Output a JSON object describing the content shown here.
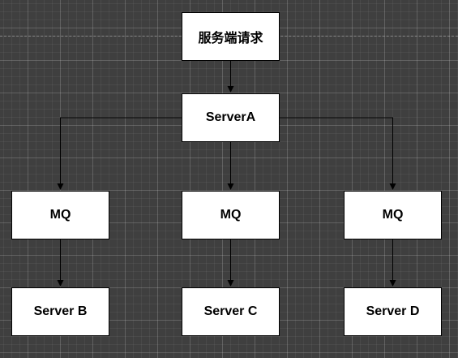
{
  "diagram": {
    "nodes": {
      "request": "服务端请求",
      "server_a": "ServerA",
      "mq_left": "MQ",
      "mq_center": "MQ",
      "mq_right": "MQ",
      "server_b": "Server B",
      "server_c": "Server C",
      "server_d": "Server D"
    },
    "edges": [
      [
        "request",
        "server_a"
      ],
      [
        "server_a",
        "mq_left"
      ],
      [
        "server_a",
        "mq_center"
      ],
      [
        "server_a",
        "mq_right"
      ],
      [
        "mq_left",
        "server_b"
      ],
      [
        "mq_center",
        "server_c"
      ],
      [
        "mq_right",
        "server_d"
      ]
    ],
    "colors": {
      "node_fill": "#ffffff",
      "node_border": "#000000",
      "edge": "#000000",
      "canvas": "#3f3f3f"
    }
  }
}
